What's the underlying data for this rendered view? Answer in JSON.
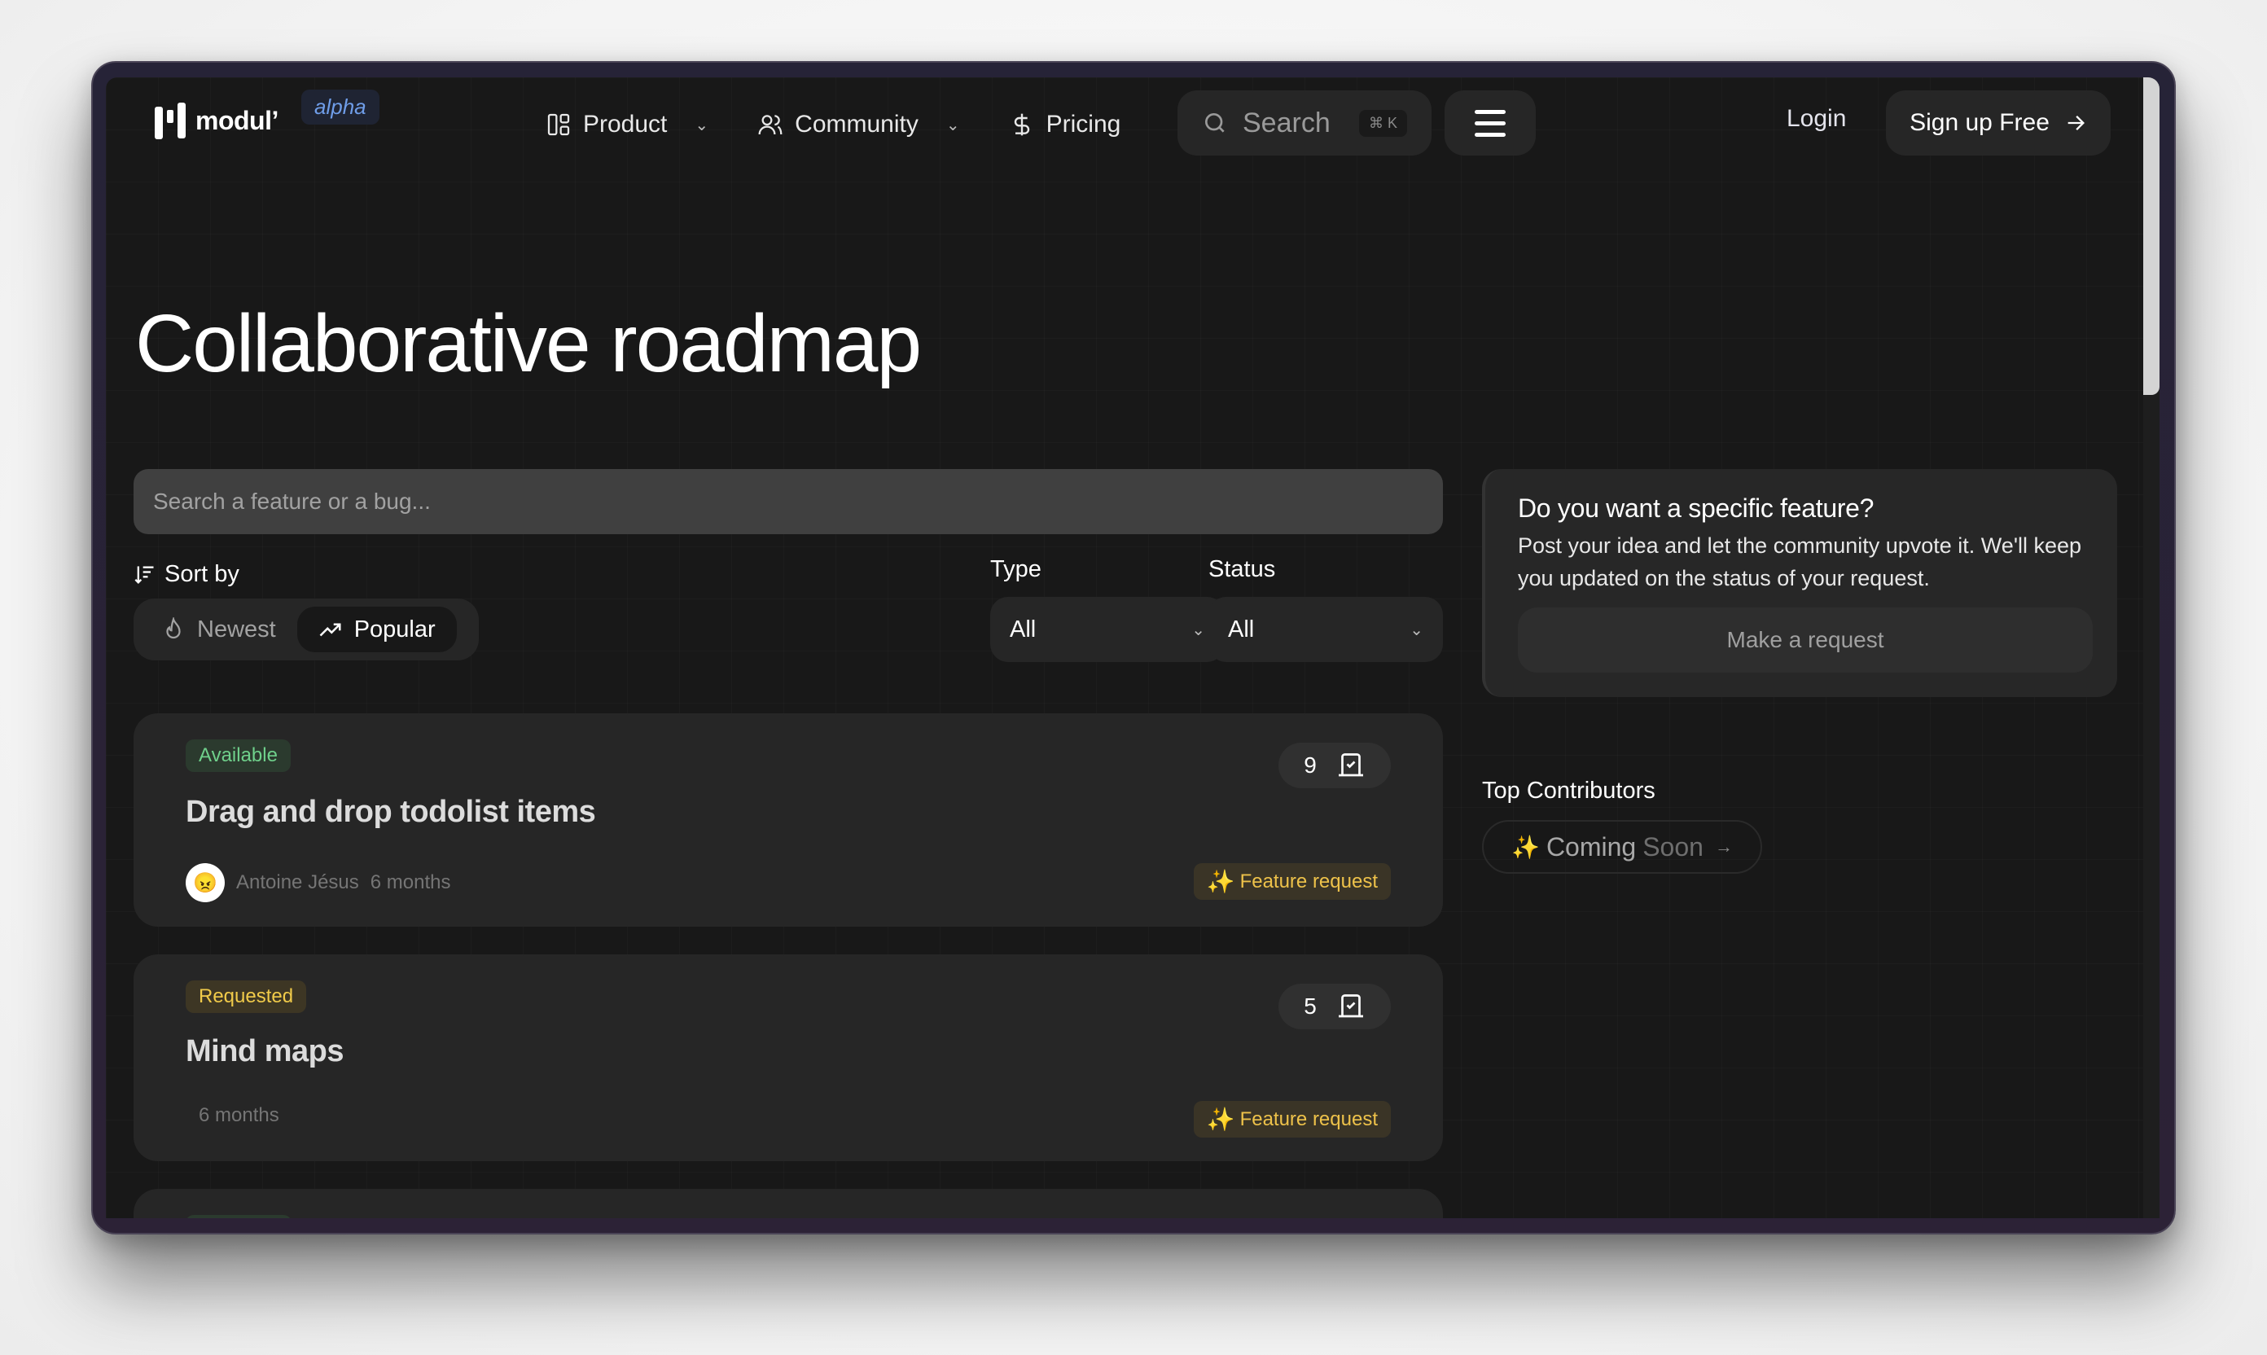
{
  "brand": {
    "name": "modul’",
    "badge": "alpha"
  },
  "nav": {
    "items": [
      {
        "label": "Product",
        "icon": "layout-grid-icon",
        "has_dropdown": true
      },
      {
        "label": "Community",
        "icon": "users-icon",
        "has_dropdown": true
      },
      {
        "label": "Pricing",
        "icon": "dollar-icon",
        "has_dropdown": false
      }
    ],
    "search_label": "Search",
    "search_shortcut": "⌘ K",
    "login": "Login",
    "signup": "Sign up Free"
  },
  "page": {
    "title": "Collaborative roadmap"
  },
  "filters": {
    "search_placeholder": "Search a feature or a bug...",
    "sort_label": "Sort by",
    "sort_options": [
      {
        "label": "Newest",
        "icon": "flame-icon",
        "active": false
      },
      {
        "label": "Popular",
        "icon": "trending-up-icon",
        "active": true
      }
    ],
    "type_label": "Type",
    "type_value": "All",
    "status_label": "Status",
    "status_value": "All"
  },
  "items": [
    {
      "status": "Available",
      "title": "Drag and drop todolist items",
      "author": "Antoine Jésus",
      "age": "6 months",
      "votes": "9",
      "type": "Feature request"
    },
    {
      "status": "Requested",
      "title": "Mind maps",
      "author": "",
      "age": "6 months",
      "votes": "5",
      "type": "Feature request"
    }
  ],
  "sidebar": {
    "request_title": "Do you want a specific feature?",
    "request_desc": "Post your idea and let the community upvote it. We'll keep you updated on the status of your request.",
    "request_button": "Make a request",
    "contributors_title": "Top Contributors",
    "coming_soon_1": "Coming",
    "coming_soon_2": "Soon"
  },
  "colors": {
    "available": "#6fd08b",
    "requested": "#f1cb4a",
    "feature_request": "#eec24a",
    "alpha": "#6f9de8",
    "frame": "#2a2235"
  }
}
